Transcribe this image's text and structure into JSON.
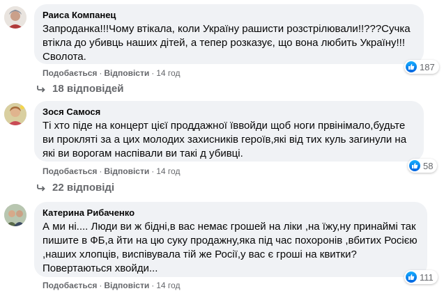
{
  "comments": [
    {
      "author": "Раиса Компанец",
      "text": "Запроданка!!!Чому втікала, коли Україну рашисти розстрілювали!!???Сучка втікла до убивць наших дітей, а тепер розказує, що вона любить Україну!!! Сволота.",
      "like_label": "Подобається",
      "reply_label": "Відповісти",
      "time": "14 год",
      "reactions": "187",
      "replies": "18 відповідей"
    },
    {
      "author": "Зося Самося",
      "text": "Ті хто піде на концерт цієї проддажної їввойди щоб ноги првінімало,будьте ви прокляті за а цих молодих захисників героїв,які від тих куль загинули на які ви ворогам наспівали ви такі д убивці.",
      "like_label": "Подобається",
      "reply_label": "Відповісти",
      "time": "14 год",
      "reactions": "58",
      "replies": "22 відповіді"
    },
    {
      "author": "Катерина Рибаченко",
      "text": "А ми ні.... Люди ви ж бідні,в вас немає грошей на ліки ,на їжу,ну принаймі так пишите в ФБ,а йти на цю суку продажну,яка під час похоронів ,вбитих Росією ,наших хлопців, виспівувала тій же Росії,у вас є гроші на квитки? Повертаються хвойди...",
      "like_label": "Подобається",
      "reply_label": "Відповісти",
      "time": "14 год",
      "reactions": "111"
    }
  ],
  "separator": "·",
  "icons": {
    "like": "thumbs-up-icon",
    "reply": "reply-arrow-icon"
  },
  "colors": {
    "bubble": "#f0f2f5",
    "secondary_text": "#65676b",
    "like_blue": "#1877f2"
  }
}
